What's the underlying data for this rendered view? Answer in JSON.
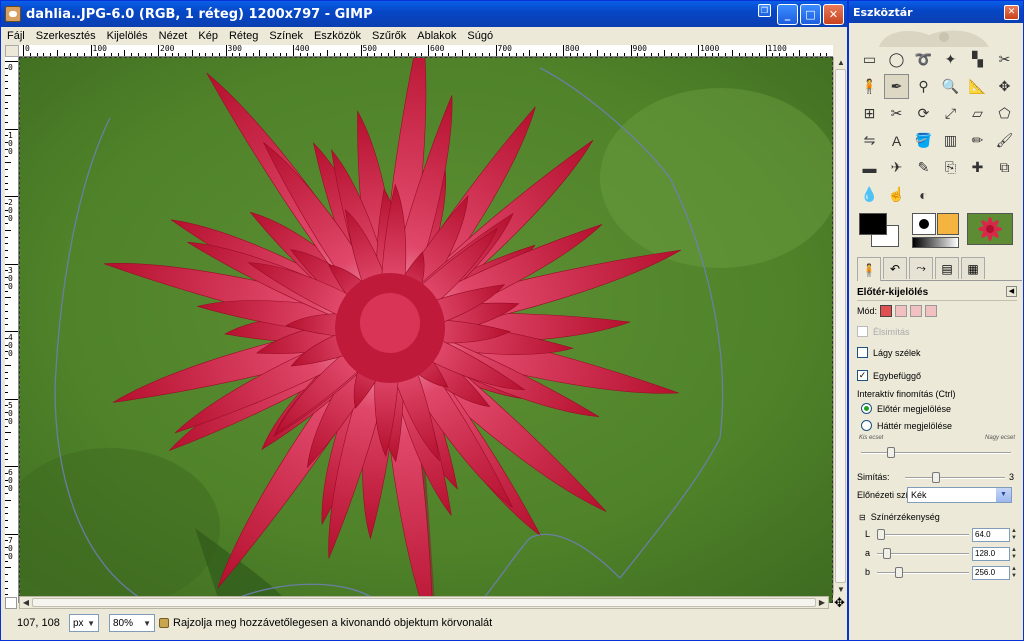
{
  "main_window": {
    "title": "dahlia..JPG-6.0 (RGB, 1 réteg) 1200x797 - GIMP",
    "menu": [
      "Fájl",
      "Szerkesztés",
      "Kijelölés",
      "Nézet",
      "Kép",
      "Réteg",
      "Színek",
      "Eszközök",
      "Szűrők",
      "Ablakok",
      "Súgó"
    ],
    "ruler_h": [
      "0",
      "100",
      "200",
      "300",
      "400",
      "500",
      "600",
      "700",
      "800",
      "900",
      "1000",
      "1100"
    ],
    "ruler_v": [
      "0",
      "100",
      "200",
      "300",
      "400",
      "500",
      "600",
      "700"
    ],
    "status": {
      "coords": "107, 108",
      "unit": "px",
      "zoom": "80%",
      "message": "Rajzolja meg hozzávetőlegesen a kivonandó objektum körvonalát"
    }
  },
  "toolbox": {
    "title": "Eszköztár",
    "tools": [
      "rect-select",
      "ellipse-select",
      "free-select",
      "fuzzy-select",
      "select-by-color",
      "scissors",
      "foreground-select",
      "paths",
      "color-picker",
      "zoom",
      "measure",
      "move",
      "align",
      "crop",
      "rotate",
      "scale",
      "shear",
      "perspective",
      "flip",
      "text",
      "bucket-fill",
      "blend",
      "pencil",
      "paintbrush",
      "eraser",
      "airbrush",
      "ink",
      "clone",
      "heal",
      "perspective-clone",
      "blur",
      "smudge",
      "dodge-burn"
    ],
    "colors": {
      "foreground": "#000000",
      "background": "#ffffff",
      "pattern": "#f5b340"
    },
    "tool_options": {
      "title": "Előtér-kijelölés",
      "mode_label": "Mód:",
      "antialias_label": "Élsimítás",
      "feather_label": "Lágy szélek",
      "contiguous_label": "Egybefüggő",
      "contiguous_checked": true,
      "refine_label": "Interaktív finomítás  (Ctrl)",
      "mark_fg_label": "Előtér megjelölése",
      "mark_bg_label": "Háttér megjelölése",
      "small_brush": "Kis ecset",
      "large_brush": "Nagy ecset",
      "smoothing_label": "Simítás:",
      "smoothing_value": "3",
      "preview_color_label": "Előnézeti szín:",
      "preview_color_value": "Kék",
      "sensitivity_label": "Színérzékenység",
      "channels": [
        {
          "name": "L",
          "value": "64.0"
        },
        {
          "name": "a",
          "value": "128.0"
        },
        {
          "name": "b",
          "value": "256.0"
        }
      ]
    }
  }
}
